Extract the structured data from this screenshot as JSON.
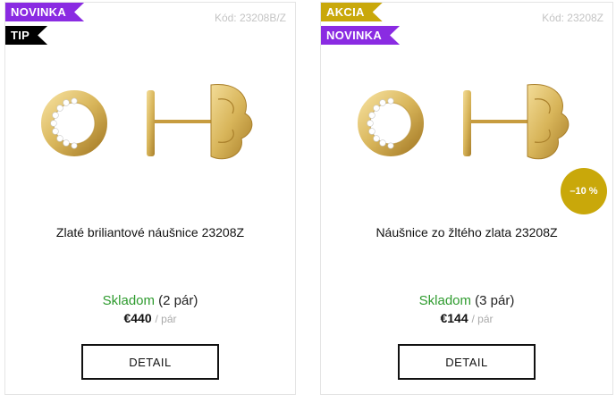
{
  "products": [
    {
      "ribbons": [
        {
          "label": "NOVINKA",
          "color": "#8a2be2"
        },
        {
          "label": "TIP",
          "color": "#000000"
        }
      ],
      "code": "Kód: 23208B/Z",
      "title": "Zlaté briliantové náušnice 23208Z",
      "stock_label": "Skladom",
      "stock_qty": "(2 pár)",
      "price": "€440",
      "price_unit": "/ pár",
      "button_label": "DETAIL"
    },
    {
      "ribbons": [
        {
          "label": "AKCIA",
          "color": "#c9a80a"
        },
        {
          "label": "NOVINKA",
          "color": "#8a2be2"
        }
      ],
      "code": "Kód: 23208Z",
      "discount": "–10 %",
      "title": "Náušnice zo žltého zlata 23208Z",
      "stock_label": "Skladom",
      "stock_qty": "(3 pár)",
      "price": "€144",
      "price_unit": "/ pár",
      "button_label": "DETAIL"
    }
  ],
  "colors": {
    "gold": "#d8b55a",
    "stock_green": "#2e9b2e",
    "purple_ribbon": "#8a2be2",
    "gold_ribbon": "#c9a80a"
  }
}
